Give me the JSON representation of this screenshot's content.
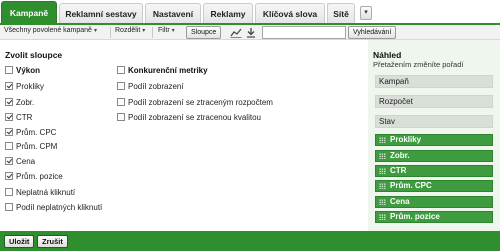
{
  "tabs": [
    {
      "label": "Kampaně",
      "active": true
    },
    {
      "label": "Reklamní sestavy",
      "active": false
    },
    {
      "label": "Nastavení",
      "active": false
    },
    {
      "label": "Reklamy",
      "active": false
    },
    {
      "label": "Klíčová slova",
      "active": false
    },
    {
      "label": "Sítě",
      "active": false
    }
  ],
  "toolbar": {
    "filter_status": "Všechny povolené kampaně",
    "segment": "Rozdělit",
    "filter": "Filtr",
    "columns": "Sloupce",
    "search_value": "",
    "search_button": "Vyhledávání"
  },
  "columns_panel": {
    "title": "Zvolit sloupce",
    "performance": {
      "label": "Výkon",
      "checked": false,
      "items": [
        {
          "label": "Prokliky",
          "checked": true
        },
        {
          "label": "Zobr.",
          "checked": true
        },
        {
          "label": "CTR",
          "checked": true
        },
        {
          "label": "Prům. CPC",
          "checked": true
        },
        {
          "label": "Prům. CPM",
          "checked": false
        },
        {
          "label": "Cena",
          "checked": true
        },
        {
          "label": "Prům. pozice",
          "checked": true
        },
        {
          "label": "Neplatná kliknutí",
          "checked": false
        },
        {
          "label": "Podíl neplatných kliknutí",
          "checked": false
        }
      ]
    },
    "competitive": {
      "label": "Konkurenční metriky",
      "checked": false,
      "items": [
        {
          "label": "Podíl zobrazení",
          "checked": false
        },
        {
          "label": "Podíl zobrazení se ztraceným rozpočtem",
          "checked": false
        },
        {
          "label": "Podíl zobrazení se ztracenou kvalitou",
          "checked": false
        }
      ]
    }
  },
  "preview": {
    "title": "Náhled",
    "subtitle": "Přetažením změníte pořadí",
    "fixed": [
      "Kampaň",
      "Rozpočet",
      "Stav"
    ],
    "draggable": [
      "Prokliky",
      "Zobr.",
      "CTR",
      "Prům. CPC",
      "Cena",
      "Prům. pozice"
    ]
  },
  "footer": {
    "save": "Uložit",
    "cancel": "Zrušit"
  },
  "colors": {
    "accent": "#2f8f2f",
    "preview_bg": "#eef6ee",
    "fixed_item": "#d9ded9"
  }
}
